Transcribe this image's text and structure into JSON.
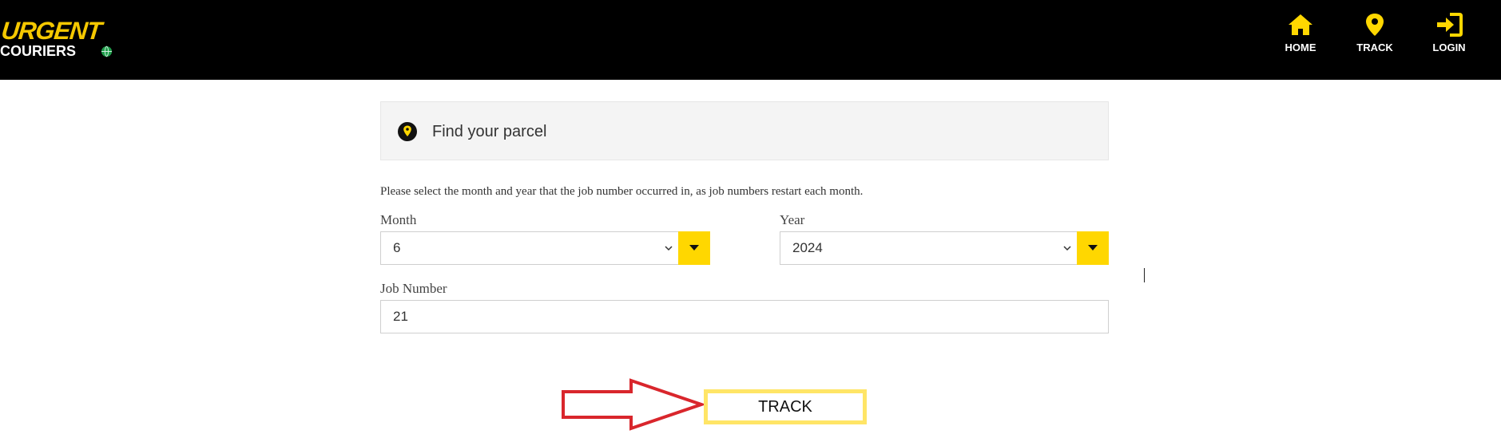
{
  "brand": {
    "line1": "URGENT",
    "line2": "COURIERS"
  },
  "nav": {
    "items": [
      {
        "label": "HOME",
        "icon": "home-icon"
      },
      {
        "label": "TRACK",
        "icon": "map-pin-icon"
      },
      {
        "label": "LOGIN",
        "icon": "login-icon"
      }
    ]
  },
  "panel": {
    "title": "Find your parcel",
    "icon": "map-pin-icon"
  },
  "instruction": "Please select the month and year that the job number occurred in, as job numbers restart each month.",
  "form": {
    "month": {
      "label": "Month",
      "value": "6"
    },
    "year": {
      "label": "Year",
      "value": "2024"
    },
    "job_number": {
      "label": "Job Number",
      "value": "21"
    }
  },
  "track_button": {
    "label": "TRACK"
  },
  "colors": {
    "accent": "#ffd700",
    "header_bg": "#000000",
    "arrow": "#d9262c",
    "button_border": "#ffe566"
  }
}
